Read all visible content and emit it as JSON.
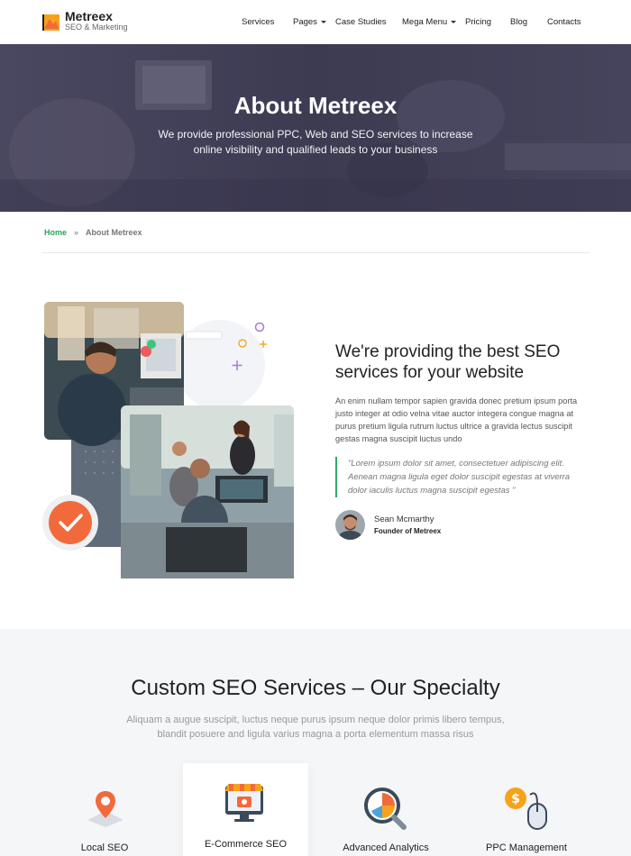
{
  "header": {
    "logo_name": "Metreex",
    "logo_tagline": "SEO & Marketing",
    "nav": [
      {
        "label": "Services"
      },
      {
        "label": "Pages"
      },
      {
        "label": "Case Studies"
      },
      {
        "label": "Mega Menu"
      },
      {
        "label": "Pricing"
      },
      {
        "label": "Blog"
      },
      {
        "label": "Contacts"
      }
    ]
  },
  "hero": {
    "title": "About Metreex",
    "subtitle": "We provide professional PPC, Web and SEO services to increase online visibility and qualified leads to your business"
  },
  "breadcrumb": {
    "home": "Home",
    "separator": "»",
    "current": "About Metreex"
  },
  "about": {
    "heading": "We're providing the best SEO services for your website",
    "paragraph": "An enim nullam tempor sapien gravida donec pretium ipsum porta justo integer at odio velna vitae auctor integera congue magna at purus pretium ligula rutrum luctus ultrice a gravida lectus suscipit gestas magna suscipit luctus undo",
    "quote": "\"Lorem ipsum dolor sit amet, consectetuer adipiscing elit. Aenean magna ligula eget dolor suscipit egestas at viverra dolor iaculis luctus magna suscipit egestas \"",
    "author_name": "Sean Mcmarthy",
    "author_role": "Founder of Metreex"
  },
  "services": {
    "title": "Custom SEO Services – Our Specialty",
    "subtitle": "Aliquam a augue suscipit, luctus neque purus ipsum neque dolor primis libero tempus, blandit posuere and ligula varius magna a porta elementum massa risus",
    "items": [
      {
        "label": "Local SEO",
        "icon": "map-pin-icon"
      },
      {
        "label": "E-Commerce SEO",
        "icon": "ecommerce-store-icon"
      },
      {
        "label": "Advanced Analytics",
        "icon": "analytics-magnifier-icon"
      },
      {
        "label": "PPC Management",
        "icon": "dollar-mouse-icon"
      }
    ]
  },
  "colors": {
    "accent_green": "#27a35a",
    "accent_orange": "#f26a3b",
    "hero_overlay": "#403e55"
  }
}
